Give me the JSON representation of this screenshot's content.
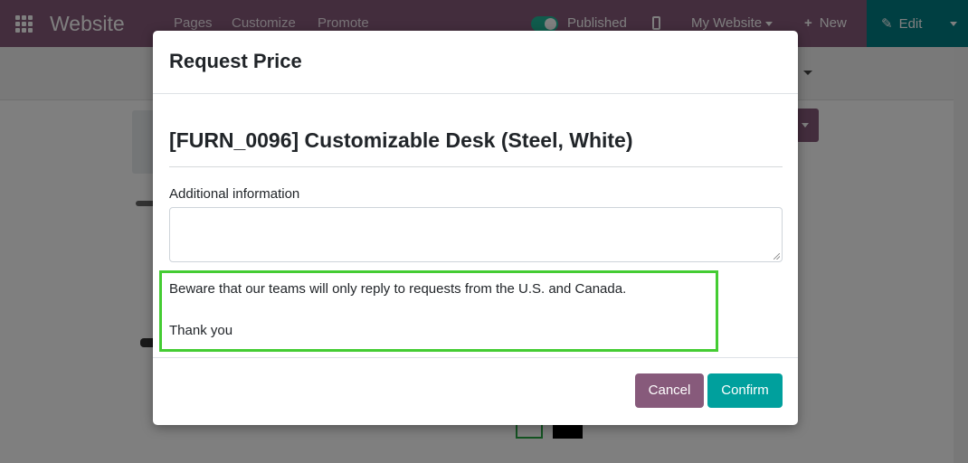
{
  "navbar": {
    "brand": "Website",
    "menu": [
      "Pages",
      "Customize",
      "Promote"
    ],
    "published_label": "Published",
    "published_on": true,
    "website_select": "My Website",
    "new_label": "New",
    "edit_label": "Edit",
    "icons": [
      "apps-grid-icon",
      "mobile-preview-icon",
      "plus-icon",
      "pencil-icon",
      "caret-down-icon"
    ]
  },
  "modal": {
    "title": "Request Price",
    "product": "[FURN_0096] Customizable Desk (Steel, White)",
    "additional_info_label": "Additional information",
    "additional_info_value": "",
    "notice": "Beware that our teams will only reply to requests from the U.S. and Canada.",
    "thanks": "Thank you",
    "cancel_label": "Cancel",
    "confirm_label": "Confirm"
  },
  "colors": {
    "navbar": "#875a7b",
    "edit_button": "#017e84",
    "cancel_button": "#875a7b",
    "confirm_button": "#00a09d",
    "highlight_border": "#44cc33",
    "toggle_on": "#21b799"
  }
}
